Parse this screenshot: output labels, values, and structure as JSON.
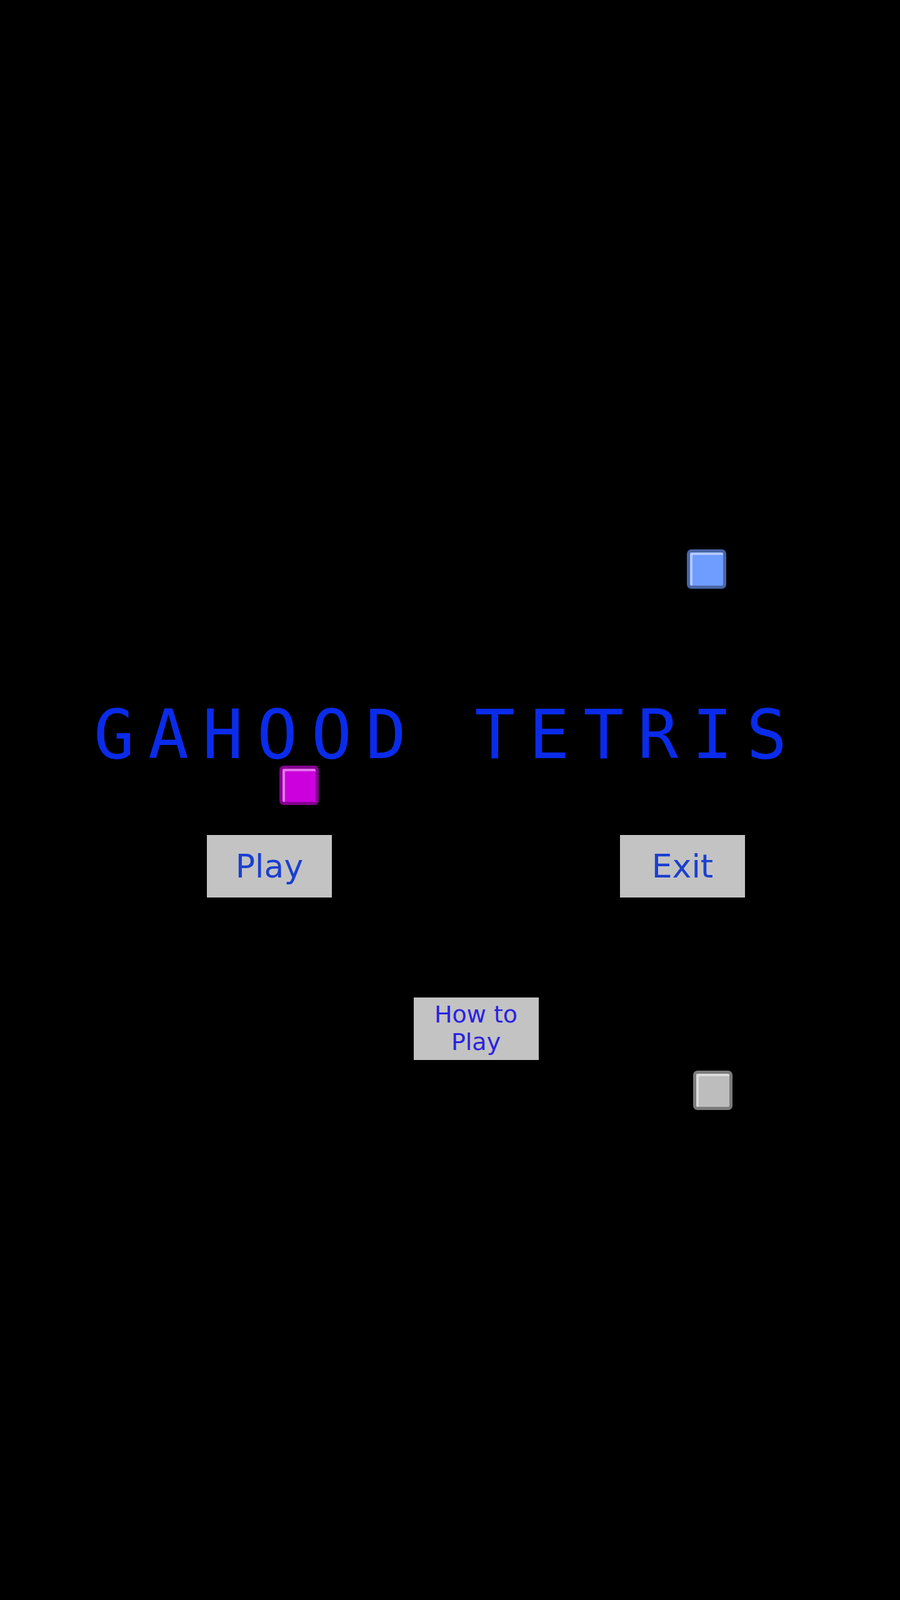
{
  "title": "GAHOOD TETRIS",
  "buttons": [
    "Play",
    "Exit"
  ],
  "help_button": "How to Play",
  "blocks": [
    {
      "color": "#6f9cff"
    },
    {
      "color": "#cc00dd"
    },
    {
      "color": "#bdbdbd"
    }
  ]
}
